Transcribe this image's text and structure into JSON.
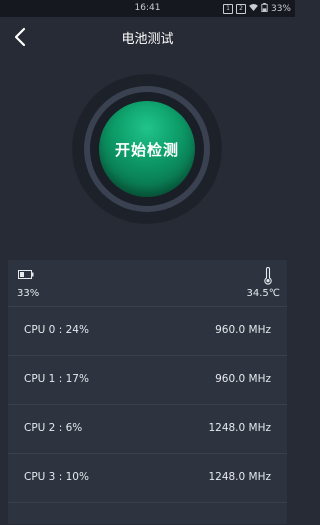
{
  "status": {
    "time": "16:41",
    "battery": "33%"
  },
  "header": {
    "title": "电池测试"
  },
  "action": {
    "start_label": "开始检测"
  },
  "summary": {
    "battery_percent": "33%",
    "temperature": "34.5℃"
  },
  "cpus": [
    {
      "name": "CPU  0 : 24%",
      "freq": "960.0 MHz"
    },
    {
      "name": "CPU  1 : 17%",
      "freq": "960.0 MHz"
    },
    {
      "name": "CPU  2 : 6%",
      "freq": "1248.0 MHz"
    },
    {
      "name": "CPU  3 : 10%",
      "freq": "1248.0 MHz"
    }
  ],
  "colors": {
    "background": "#262b35",
    "panel": "#2d333f",
    "accent_green": "#0ea06b"
  }
}
